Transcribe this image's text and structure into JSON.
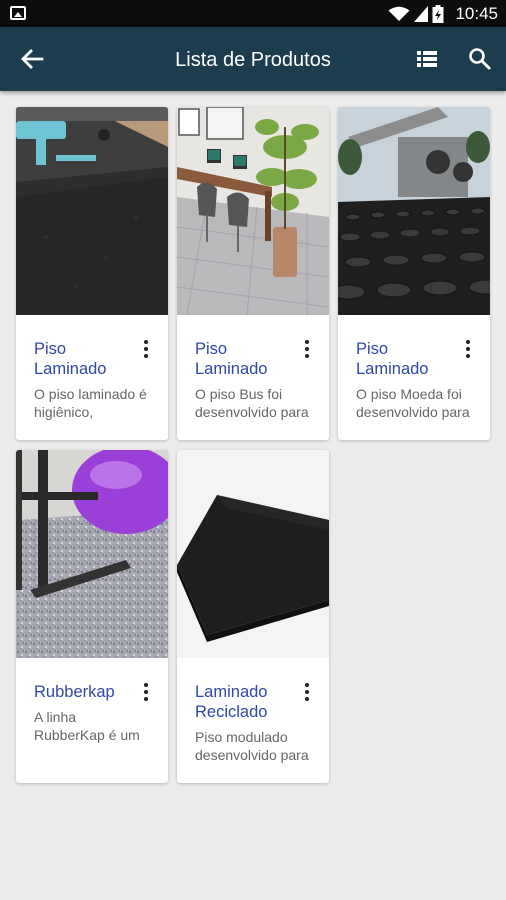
{
  "status_bar": {
    "time": "10:45"
  },
  "app_bar": {
    "title": "Lista de Produtos"
  },
  "products": [
    {
      "name": "Piso\nLaminado",
      "desc": "O piso laminado é\nhigiênico,"
    },
    {
      "name": "Piso\nLaminado",
      "desc": "O piso Bus foi\ndesenvolvido para"
    },
    {
      "name": "Piso\nLaminado",
      "desc": "O piso Moeda foi\ndesenvolvido para"
    },
    {
      "name": "Rubberkap",
      "desc": "A linha\nRubberKap é um"
    },
    {
      "name": "Laminado\nReciclado",
      "desc": "Piso modulado\ndesenvolvido para"
    }
  ],
  "colors": {
    "status_bar": "#0d0d0d",
    "app_bar": "#1c3d4d",
    "background": "#ececec",
    "product_name": "#3048a6",
    "description": "#666666"
  },
  "icons": [
    "image-icon",
    "wifi-icon",
    "signal-icon",
    "battery-icon",
    "back-arrow-icon",
    "list-view-icon",
    "search-icon",
    "more-vert-icon"
  ]
}
